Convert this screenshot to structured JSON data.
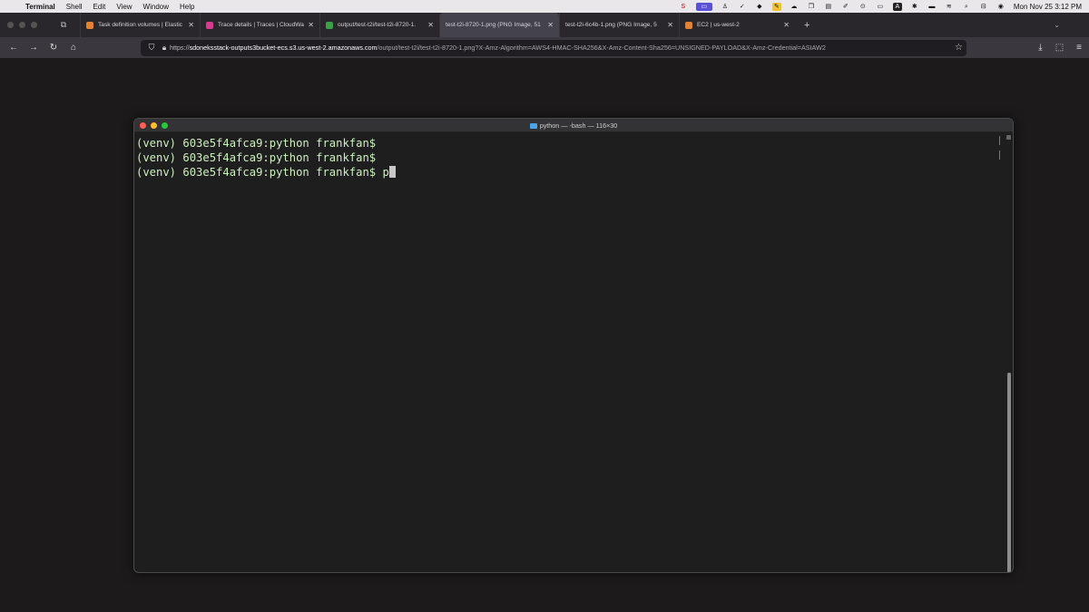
{
  "menubar": {
    "app": "Terminal",
    "items": [
      "Shell",
      "Edit",
      "View",
      "Window",
      "Help"
    ],
    "clock": "Mon Nov 25  3:12 PM"
  },
  "browser": {
    "tabs": [
      {
        "title": "Task definition volumes | Elastic",
        "color": "#e3822f"
      },
      {
        "title": "Trace details | Traces | CloudWa",
        "color": "#d83a8f"
      },
      {
        "title": "output/test-t2i/test-t2i-8720-1.",
        "color": "#3aa14a"
      },
      {
        "title": "test-t2i-8720-1.png (PNG Image, 51",
        "color": "#888888"
      },
      {
        "title": "test-t2i-6c4b-1.png (PNG Image, 5",
        "color": "#888888"
      },
      {
        "title": "EC2 | us-west-2",
        "color": "#e3822f"
      }
    ],
    "url_scheme": "https://",
    "url_host": "sdoneksstack-outputs3bucket-ecs.s3.us-west-2.amazonaws.com",
    "url_path": "/output/test-t2i/test-t2i-8720-1.png?X-Amz-Algorithm=AWS4-HMAC-SHA256&X-Amz-Content-Sha256=UNSIGNED-PAYLOAD&X-Amz-Credential=ASIAW2"
  },
  "terminal": {
    "title": "python — -bash — 116×30",
    "lines": [
      "(venv) 603e5f4afca9:python frankfan$",
      "(venv) 603e5f4afca9:python frankfan$",
      "(venv) 603e5f4afca9:python frankfan$ p"
    ],
    "text_color": "#cfeec0"
  }
}
